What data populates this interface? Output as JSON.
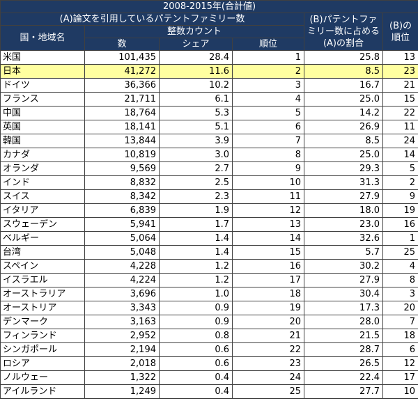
{
  "header": {
    "title": "2008-2015年(合計値)",
    "group_a": "(A)論文を引用しているパテントファミリー数",
    "country_col": "国・地域名",
    "integer_count": "整数カウント",
    "col_count": "数",
    "col_share": "シェア",
    "col_rank": "順位",
    "col_b_ratio": "(B)パテントファミリー数に占める(A)の割合",
    "col_b_rank": "(B)の順位"
  },
  "highlight_country": "日本",
  "rows": [
    {
      "country": "米国",
      "count": "101,435",
      "share": "28.4",
      "rank": "1",
      "ratio": "25.8",
      "b_rank": "13"
    },
    {
      "country": "日本",
      "count": "41,272",
      "share": "11.6",
      "rank": "2",
      "ratio": "8.5",
      "b_rank": "23"
    },
    {
      "country": "ドイツ",
      "count": "36,366",
      "share": "10.2",
      "rank": "3",
      "ratio": "16.7",
      "b_rank": "21"
    },
    {
      "country": "フランス",
      "count": "21,711",
      "share": "6.1",
      "rank": "4",
      "ratio": "25.0",
      "b_rank": "15"
    },
    {
      "country": "中国",
      "count": "18,764",
      "share": "5.3",
      "rank": "5",
      "ratio": "14.2",
      "b_rank": "22"
    },
    {
      "country": "英国",
      "count": "18,141",
      "share": "5.1",
      "rank": "6",
      "ratio": "26.9",
      "b_rank": "11"
    },
    {
      "country": "韓国",
      "count": "13,844",
      "share": "3.9",
      "rank": "7",
      "ratio": "8.5",
      "b_rank": "24"
    },
    {
      "country": "カナダ",
      "count": "10,819",
      "share": "3.0",
      "rank": "8",
      "ratio": "25.0",
      "b_rank": "14"
    },
    {
      "country": "オランダ",
      "count": "9,569",
      "share": "2.7",
      "rank": "9",
      "ratio": "29.3",
      "b_rank": "5"
    },
    {
      "country": "インド",
      "count": "8,832",
      "share": "2.5",
      "rank": "10",
      "ratio": "31.3",
      "b_rank": "2"
    },
    {
      "country": "スイス",
      "count": "8,342",
      "share": "2.3",
      "rank": "11",
      "ratio": "27.9",
      "b_rank": "9"
    },
    {
      "country": "イタリア",
      "count": "6,839",
      "share": "1.9",
      "rank": "12",
      "ratio": "18.0",
      "b_rank": "19"
    },
    {
      "country": "スウェーデン",
      "count": "5,941",
      "share": "1.7",
      "rank": "13",
      "ratio": "23.0",
      "b_rank": "16"
    },
    {
      "country": "ベルギー",
      "count": "5,064",
      "share": "1.4",
      "rank": "14",
      "ratio": "32.6",
      "b_rank": "1"
    },
    {
      "country": "台湾",
      "count": "5,048",
      "share": "1.4",
      "rank": "15",
      "ratio": "5.7",
      "b_rank": "25"
    },
    {
      "country": "スペイン",
      "count": "4,228",
      "share": "1.2",
      "rank": "16",
      "ratio": "30.2",
      "b_rank": "4"
    },
    {
      "country": "イスラエル",
      "count": "4,224",
      "share": "1.2",
      "rank": "17",
      "ratio": "27.9",
      "b_rank": "8"
    },
    {
      "country": "オーストラリア",
      "count": "3,696",
      "share": "1.0",
      "rank": "18",
      "ratio": "30.4",
      "b_rank": "3"
    },
    {
      "country": "オーストリア",
      "count": "3,343",
      "share": "0.9",
      "rank": "19",
      "ratio": "17.3",
      "b_rank": "20"
    },
    {
      "country": "デンマーク",
      "count": "3,163",
      "share": "0.9",
      "rank": "20",
      "ratio": "28.0",
      "b_rank": "7"
    },
    {
      "country": "フィンランド",
      "count": "2,952",
      "share": "0.8",
      "rank": "21",
      "ratio": "21.5",
      "b_rank": "18"
    },
    {
      "country": "シンガポール",
      "count": "2,194",
      "share": "0.6",
      "rank": "22",
      "ratio": "28.7",
      "b_rank": "6"
    },
    {
      "country": "ロシア",
      "count": "2,018",
      "share": "0.6",
      "rank": "23",
      "ratio": "26.5",
      "b_rank": "12"
    },
    {
      "country": "ノルウェー",
      "count": "1,322",
      "share": "0.4",
      "rank": "24",
      "ratio": "22.4",
      "b_rank": "17"
    },
    {
      "country": "アイルランド",
      "count": "1,249",
      "share": "0.4",
      "rank": "25",
      "ratio": "27.7",
      "b_rank": "10"
    }
  ]
}
